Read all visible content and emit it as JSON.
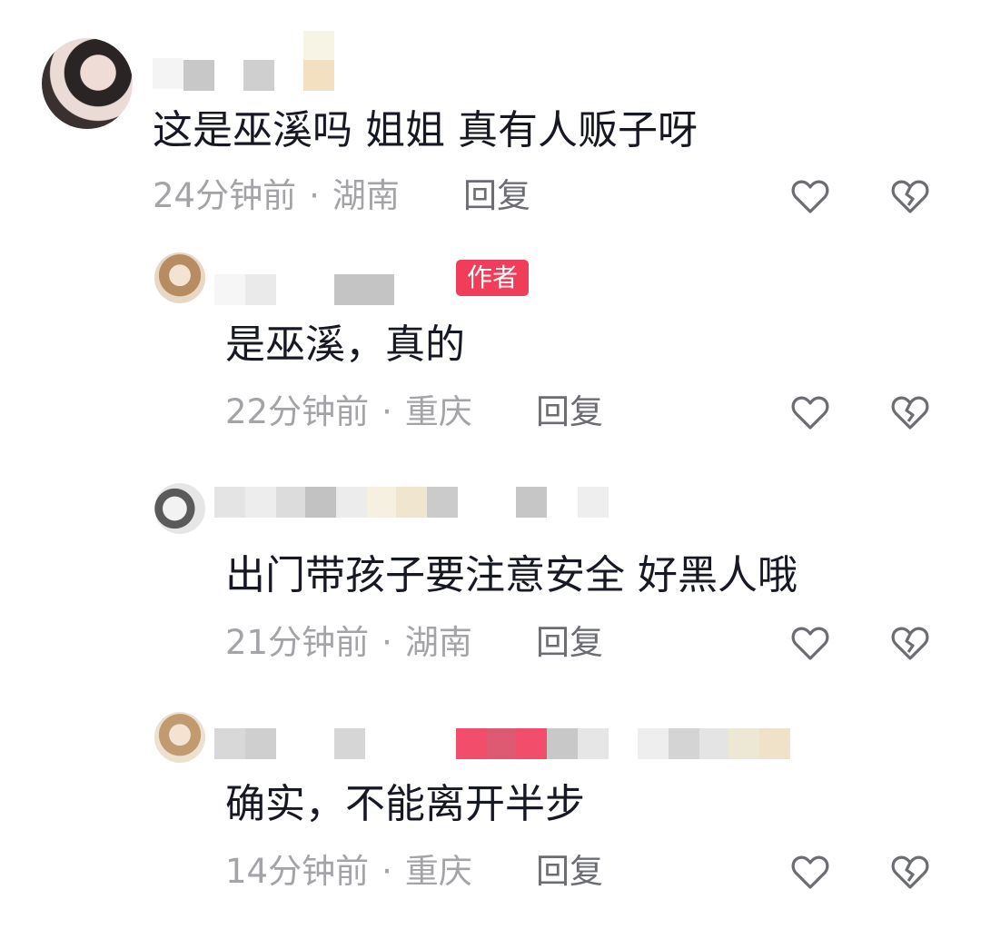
{
  "badge": {
    "author_label": "作者",
    "color": "#ef3d5a"
  },
  "comments": [
    {
      "text": "这是巫溪吗 姐姐 真有人贩子呀",
      "time": "24分钟前",
      "location": "湖南",
      "reply_label": "回复",
      "is_author": false,
      "like_icon": "heart-outline-icon",
      "dislike_icon": "broken-heart-icon"
    },
    {
      "text": "是巫溪，真的",
      "time": "22分钟前",
      "location": "重庆",
      "reply_label": "回复",
      "is_author": true,
      "like_icon": "heart-outline-icon",
      "dislike_icon": "broken-heart-icon"
    },
    {
      "text": "出门带孩子要注意安全 好黑人哦",
      "time": "21分钟前",
      "location": "湖南",
      "reply_label": "回复",
      "is_author": false,
      "like_icon": "heart-outline-icon",
      "dislike_icon": "broken-heart-icon"
    },
    {
      "text": "确实，不能离开半步",
      "time": "14分钟前",
      "location": "重庆",
      "reply_label": "回复",
      "is_author": false,
      "like_icon": "heart-outline-icon",
      "dislike_icon": "broken-heart-icon"
    }
  ]
}
